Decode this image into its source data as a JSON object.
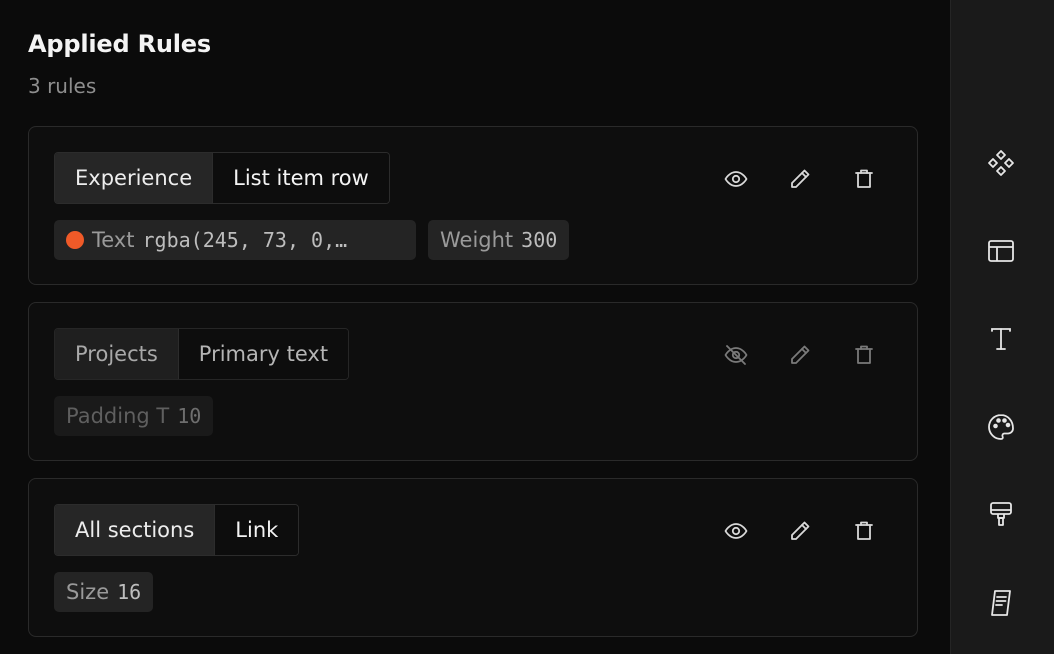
{
  "panel": {
    "title": "Applied Rules",
    "count_label": "3 rules"
  },
  "rules": [
    {
      "scope": "Experience",
      "target": "List item row",
      "visible": true,
      "chips": [
        {
          "label": "Text",
          "value": "rgba(245, 73, 0,…",
          "swatch": "#f54900"
        },
        {
          "label": "Weight",
          "value": "300"
        }
      ]
    },
    {
      "scope": "Projects",
      "target": "Primary text",
      "visible": false,
      "chips": [
        {
          "label": "Padding T",
          "value": "10"
        }
      ]
    },
    {
      "scope": "All sections",
      "target": "Link",
      "visible": true,
      "chips": [
        {
          "label": "Size",
          "value": "16"
        }
      ]
    }
  ],
  "rail": {
    "icons": [
      "components-icon",
      "layout-icon",
      "typography-icon",
      "palette-icon",
      "paint-roller-icon",
      "notes-icon"
    ]
  },
  "colors": {
    "accent_swatch": "#f54900",
    "background": "#0b0b0b",
    "rail_background": "#1a1a1a"
  }
}
